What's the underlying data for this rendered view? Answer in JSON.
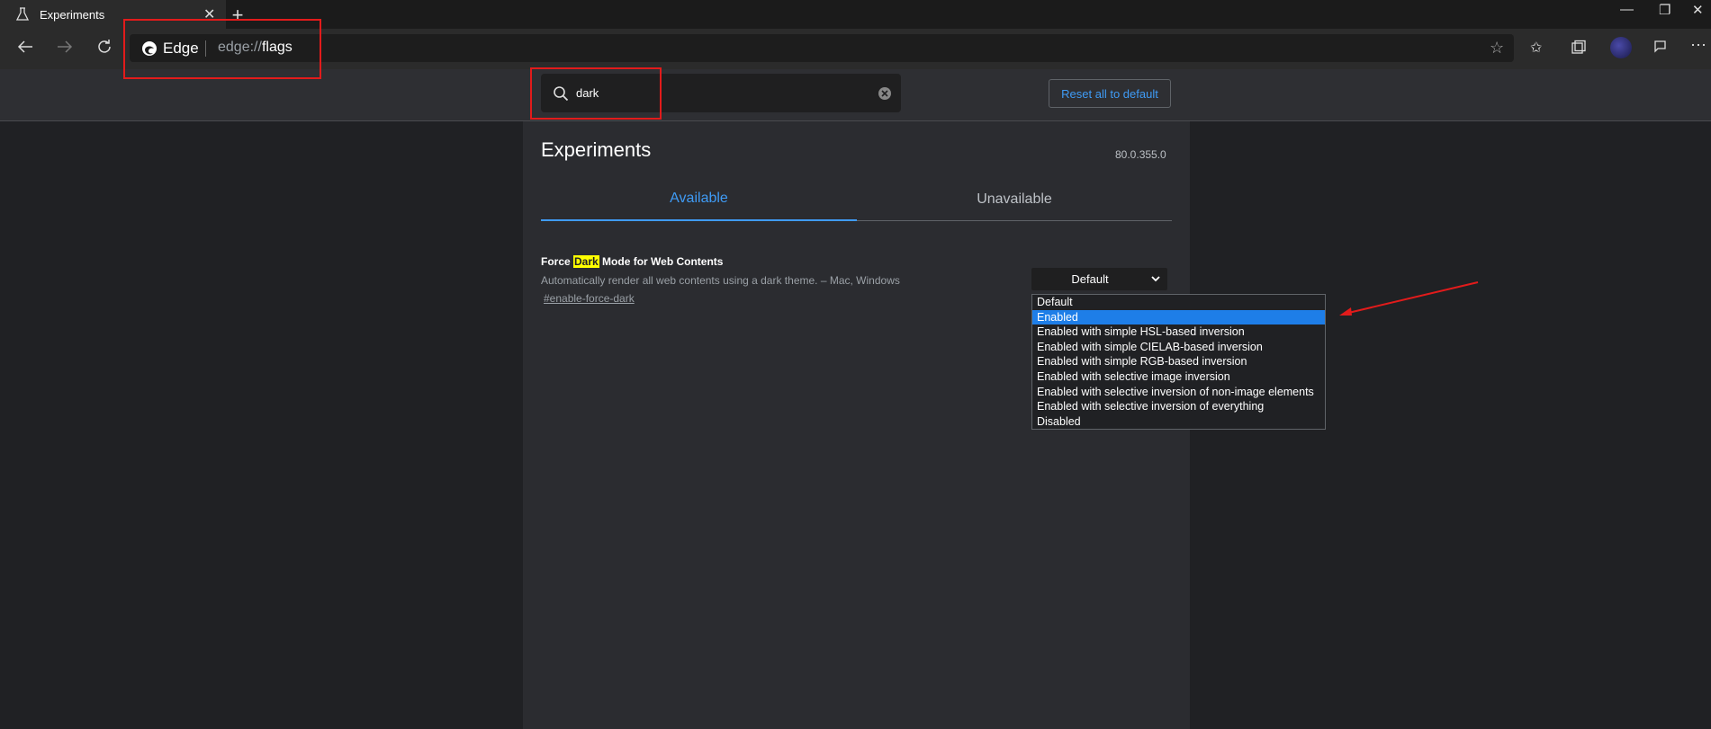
{
  "tab": {
    "title": "Experiments",
    "icon": "flask-icon"
  },
  "address": {
    "brand": "Edge",
    "url_prefix": "edge://",
    "url_page": "flags"
  },
  "search": {
    "value": "dark"
  },
  "reset_label": "Reset all to default",
  "page": {
    "title": "Experiments",
    "version": "80.0.355.0",
    "tabs": [
      "Available",
      "Unavailable"
    ]
  },
  "flag": {
    "name_before": "Force ",
    "name_highlight": "Dark",
    "name_after": " Mode for Web Contents",
    "description": "Automatically render all web contents using a dark theme. – Mac, Windows",
    "link": "#enable-force-dark",
    "selected": "Default",
    "options": [
      "Default",
      "Enabled",
      "Enabled with simple HSL-based inversion",
      "Enabled with simple CIELAB-based inversion",
      "Enabled with simple RGB-based inversion",
      "Enabled with selective image inversion",
      "Enabled with selective inversion of non-image elements",
      "Enabled with selective inversion of everything",
      "Disabled"
    ]
  },
  "colors": {
    "accent": "#3f9bf5",
    "highlight": "#ffff00",
    "annotation": "#e21b1b",
    "selected_option": "#1e7ee8"
  }
}
